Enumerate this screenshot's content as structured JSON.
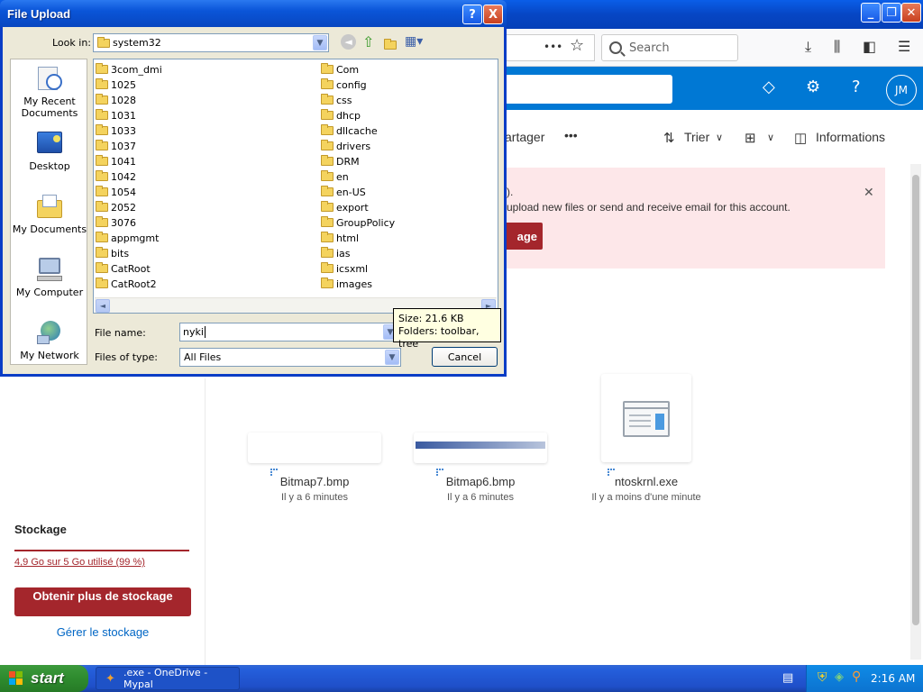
{
  "dialog": {
    "title": "File Upload",
    "help_btn": "?",
    "close_btn": "X",
    "look_in_label": "Look in:",
    "look_in_value": "system32",
    "file_name_label": "File name:",
    "file_name_value": "nyki",
    "files_of_type_label": "Files of type:",
    "files_of_type_value": "All Files",
    "cancel_label": "Cancel",
    "places": [
      "My Recent Documents",
      "Desktop",
      "My Documents",
      "My Computer",
      "My Network"
    ],
    "files_col1": [
      "3com_dmi",
      "1025",
      "1028",
      "1031",
      "1033",
      "1037",
      "1041",
      "1042",
      "1054",
      "2052",
      "3076",
      "appmgmt",
      "bits",
      "CatRoot",
      "CatRoot2"
    ],
    "files_col2": [
      "Com",
      "config",
      "css",
      "dhcp",
      "dllcache",
      "drivers",
      "DRM",
      "en",
      "en-US",
      "export",
      "GroupPolicy",
      "html",
      "ias",
      "icsxml",
      "images"
    ],
    "tooltip_line1": "Size: 21.6 KB",
    "tooltip_line2": "Folders: toolbar, tree"
  },
  "browser": {
    "search_placeholder": "Search",
    "dots": "•••",
    "star": "☆"
  },
  "onedrive": {
    "avatar_initials": "JM",
    "cmd_share": "artager",
    "cmd_more": "•••",
    "cmd_sort": "Trier",
    "cmd_info": "Informations",
    "banner_line1": ").",
    "banner_line2": "upload new files or send and receive email for this account.",
    "banner_btn": "age",
    "banner_close": "✕",
    "storage_title": "Stockage",
    "storage_used": "4,9 Go sur 5 Go utilisé (99 %)",
    "storage_fraction": 0.99,
    "storage_btn": "Obtenir plus de stockage",
    "storage_manage": "Gérer le stockage",
    "files": [
      {
        "name": "Bitmap7.bmp",
        "modified": "Il y a 6 minutes"
      },
      {
        "name": "Bitmap6.bmp",
        "modified": "Il y a 6 minutes"
      },
      {
        "name": "ntoskrnl.exe",
        "modified": "Il y a moins d'une minute"
      }
    ]
  },
  "taskbar": {
    "start": "start",
    "task_item": ".exe - OneDrive - Mypal",
    "clock": "2:16 AM"
  }
}
